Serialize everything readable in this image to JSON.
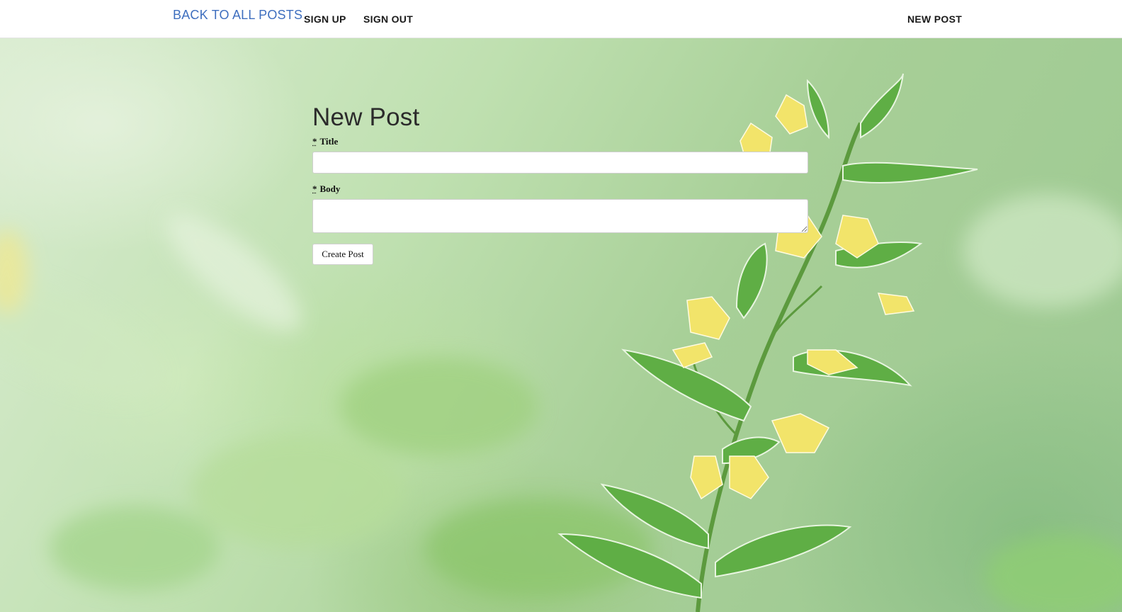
{
  "nav": {
    "brand_label": "BACK TO ALL POSTS",
    "sign_up_label": "SIGN UP",
    "sign_out_label": "SIGN OUT",
    "new_post_label": "NEW POST"
  },
  "form": {
    "heading": "New Post",
    "required_marker": "*",
    "title_label": "Title",
    "body_label": "Body",
    "title_value": "",
    "body_value": "",
    "submit_label": "Create Post"
  },
  "colors": {
    "brand_link": "#3f6fbf",
    "background_green": "#a8cf98",
    "flower_yellow": "#f2e46a",
    "leaf_green": "#5fae45"
  },
  "background_image": "green foliage with yellow flowering stem"
}
